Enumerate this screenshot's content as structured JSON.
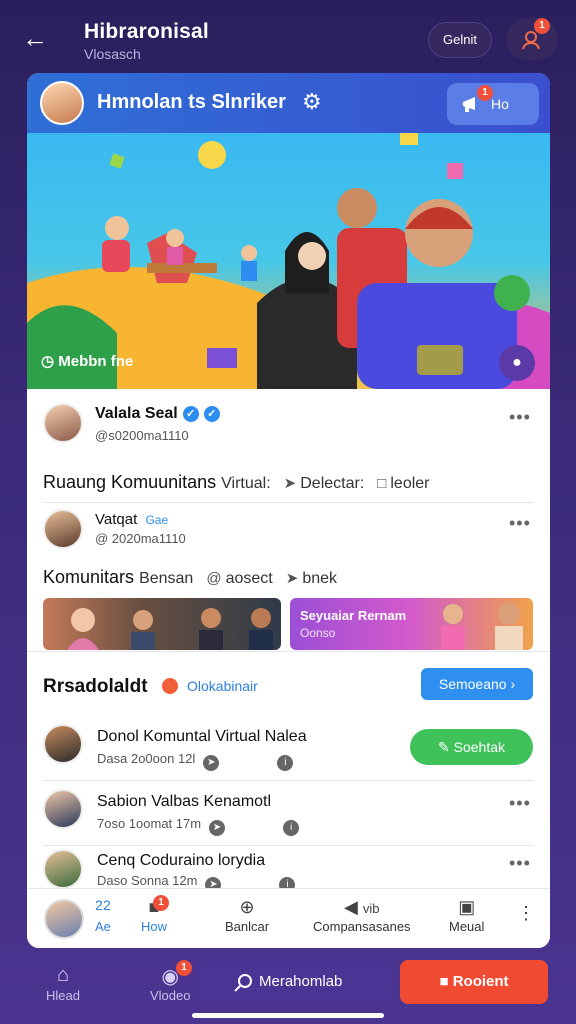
{
  "topbar": {
    "back_icon": "arrow-left-icon",
    "title": "Hibraronisal",
    "subtitle": "Vlosasch",
    "pill_label": "Gelnit",
    "user_badge": "1"
  },
  "card_header": {
    "title": "Hmnolan ts Slnriker",
    "button_label": "Ho",
    "button_badge": "1"
  },
  "hero": {
    "caption": "Mebbn fne"
  },
  "post1": {
    "name": "Valala Seal",
    "handle": "@s0200ma1110",
    "text_main": "Ruaung Komuunitans",
    "text_soft": "Virtual:",
    "tag1": "Delectar:",
    "tag2": "leoler"
  },
  "post2": {
    "name": "Vatqat",
    "badge": "Gae",
    "handle": "@ 2020ma1110",
    "text_main": "Komunitars",
    "text_soft": "Bensan",
    "tag1": "aosect",
    "tag2": "bnek"
  },
  "thumb_b": {
    "title": "Seyuaiar Rernam",
    "sub": "Oonso"
  },
  "section": {
    "title": "Rrsadolaldt",
    "live_label": "Olokabinair",
    "button_label": "Semoeano"
  },
  "list": [
    {
      "name": "Donol Komuntal Virtual Nalea",
      "meta": "Dasa 2o0oon 12l",
      "action": "Soehtak"
    },
    {
      "name": "Sabion Valbas Kenamotl",
      "meta": "7oso 1oomat 17m",
      "action": ""
    },
    {
      "name": "Cenq Coduraino lorydia",
      "meta": "Daso Sonna 12m",
      "action": ""
    }
  ],
  "footer": {
    "count_top": "22",
    "count_bottom": "Ae",
    "now_label": "How",
    "item3": "Banlcar",
    "item4": "Compansasanes",
    "item4_top": "vib",
    "item5": "Meual",
    "now_badge": "1"
  },
  "bottom_nav": {
    "home_label": "Hlead",
    "video_label": "Vlodeo",
    "video_badge": "1",
    "search_label": "Merahomlab",
    "action_label": "Rooient"
  }
}
